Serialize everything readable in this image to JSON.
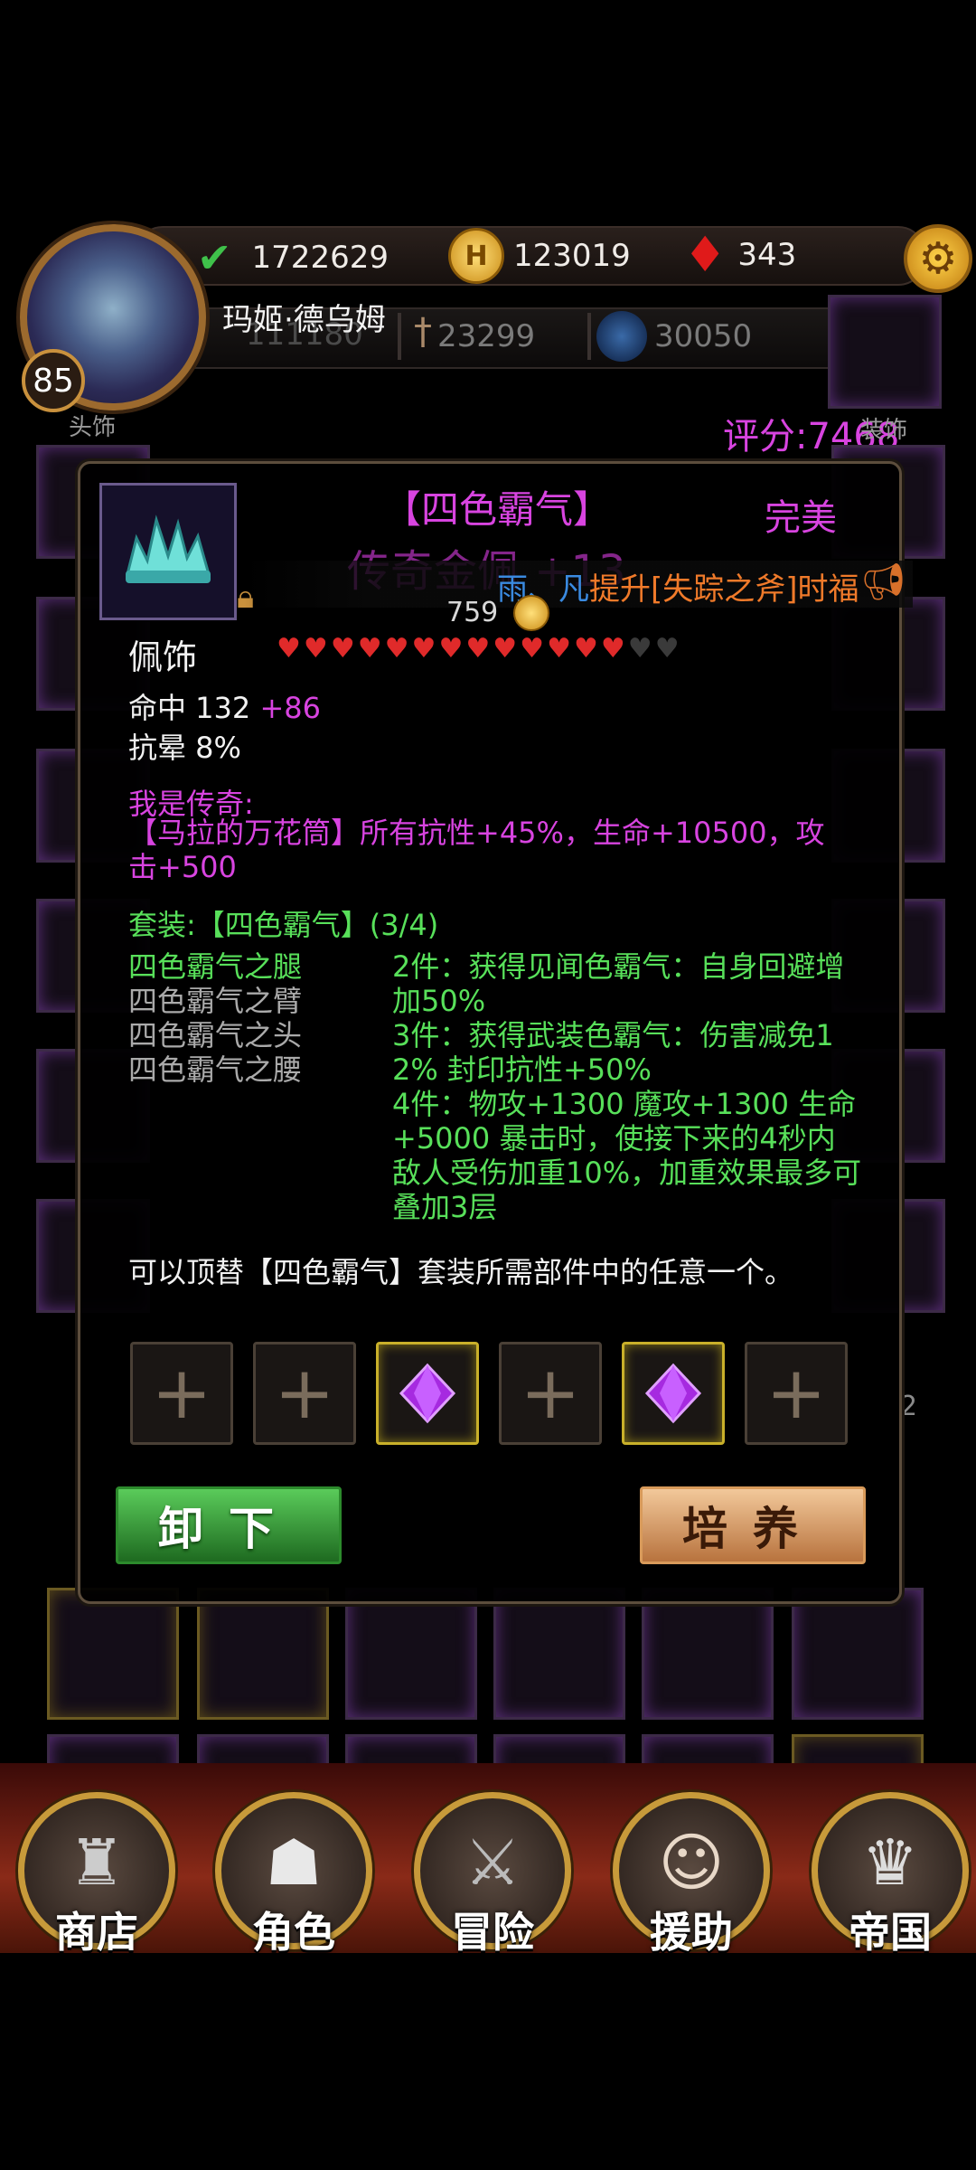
{
  "currency": {
    "exp": "1722629",
    "gold": "123019",
    "gems": "343"
  },
  "character": {
    "name": "玛姬·德乌姆",
    "level": "85",
    "stat1": "111180",
    "attack": "23299",
    "defense": "30050",
    "score": "评分:7468"
  },
  "slot_labels": {
    "head": "头饰",
    "right_top": "装饰",
    "right_2": "2"
  },
  "item": {
    "set_title": "【四色霸气】",
    "quality": "完美",
    "name": "传奇金佩",
    "enhance": "+13",
    "marquee_user": "雨、凡",
    "marquee_text": "提升[失踪之斧]时福",
    "price": "759",
    "type": "佩饰",
    "hearts_filled": 13,
    "hearts_total": 15,
    "stat_hit_label": "命中 132",
    "stat_hit_bonus": "+86",
    "stat_stun": "抗晕 8%",
    "legend_header": "我是传奇:",
    "legend_text": "【马拉的万花筒】所有抗性+45%，生命+10500，攻击+500",
    "set_header": "套装:【四色霸气】(3/4)",
    "set_pieces": [
      "四色霸气之腿",
      "四色霸气之臂",
      "四色霸气之头",
      "四色霸气之腰"
    ],
    "set_bonuses": [
      "2件：获得见闻色霸气：自身回避增加50%",
      "3件：获得武装色霸气：伤害减免12% 封印抗性+50%",
      "4件：物攻+1300 魔攻+1300 生命+5000 暴击时，使接下来的4秒内敌人受伤加重10%，加重效果最多可叠加3层"
    ],
    "replace_note": "可以顶替【四色霸气】套装所需部件中的任意一个。",
    "socket_plus": "+"
  },
  "buttons": {
    "unequip": "卸下",
    "train": "培养"
  },
  "nav": [
    "商店",
    "角色",
    "冒险",
    "援助",
    "帝国"
  ],
  "colors": {
    "legend_purple": "#d844e0",
    "set_green": "#58e05a",
    "heart_red": "#e02a2a"
  }
}
